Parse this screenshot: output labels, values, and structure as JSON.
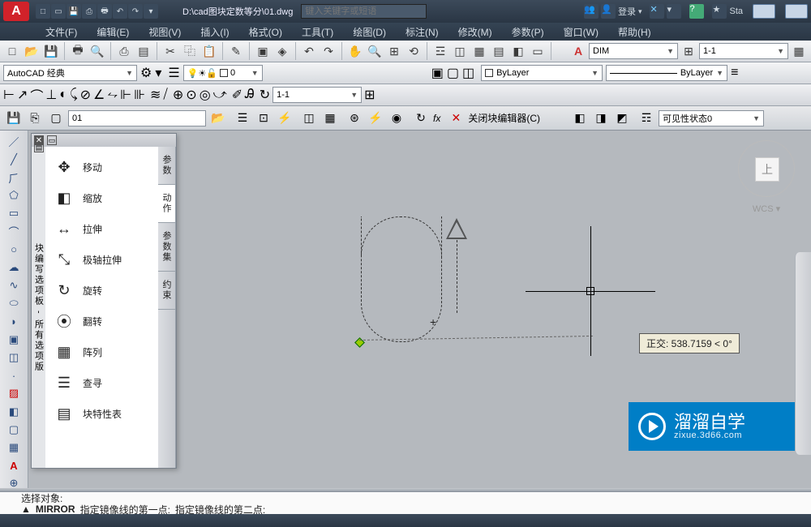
{
  "title_path": "D:\\cad图块定数等分\\01.dwg",
  "search_placeholder": "键入关键字或短语",
  "login_label": "登录",
  "menus": [
    "文件(F)",
    "编辑(E)",
    "视图(V)",
    "插入(I)",
    "格式(O)",
    "工具(T)",
    "绘图(D)",
    "标注(N)",
    "修改(M)",
    "参数(P)",
    "窗口(W)",
    "帮助(H)"
  ],
  "workspace": "AutoCAD 经典",
  "layer_value": "0",
  "dim_style": "DIM",
  "dim_scale": "1-1",
  "color_value": "ByLayer",
  "linetype_value": "ByLayer",
  "annoscale": "1-1",
  "block_name": "01",
  "close_block_editor": "关闭块编辑器(C)",
  "vis_state": "可见性状态0",
  "palette_title": "块编写选项板 - 所有选项版",
  "palette_tabs": [
    "参数",
    "动作",
    "参数集",
    "约束"
  ],
  "palette_items": [
    {
      "icon": "✥",
      "label": "移动"
    },
    {
      "icon": "◧",
      "label": "缩放"
    },
    {
      "icon": "↔",
      "label": "拉伸"
    },
    {
      "icon": "⤡",
      "label": "极轴拉伸"
    },
    {
      "icon": "↻",
      "label": "旋转"
    },
    {
      "icon": "⦿",
      "label": "翻转"
    },
    {
      "icon": "▦",
      "label": "阵列"
    },
    {
      "icon": "☰",
      "label": "查寻"
    },
    {
      "icon": "▤",
      "label": "块特性表"
    }
  ],
  "tooltip": "正交: 538.7159 < 0°",
  "viewcube_face": "上",
  "wcs_label": "WCS ▾",
  "cmd_line1": "选择对象:",
  "cmd_prefix": "MIRROR",
  "cmd_line2a": "指定镜像线的第一点:",
  "cmd_line2b": "指定镜像线的第二点:",
  "watermark_main": "溜溜自学",
  "watermark_sub": "zixue.3d66.com",
  "star_label": "Sta"
}
